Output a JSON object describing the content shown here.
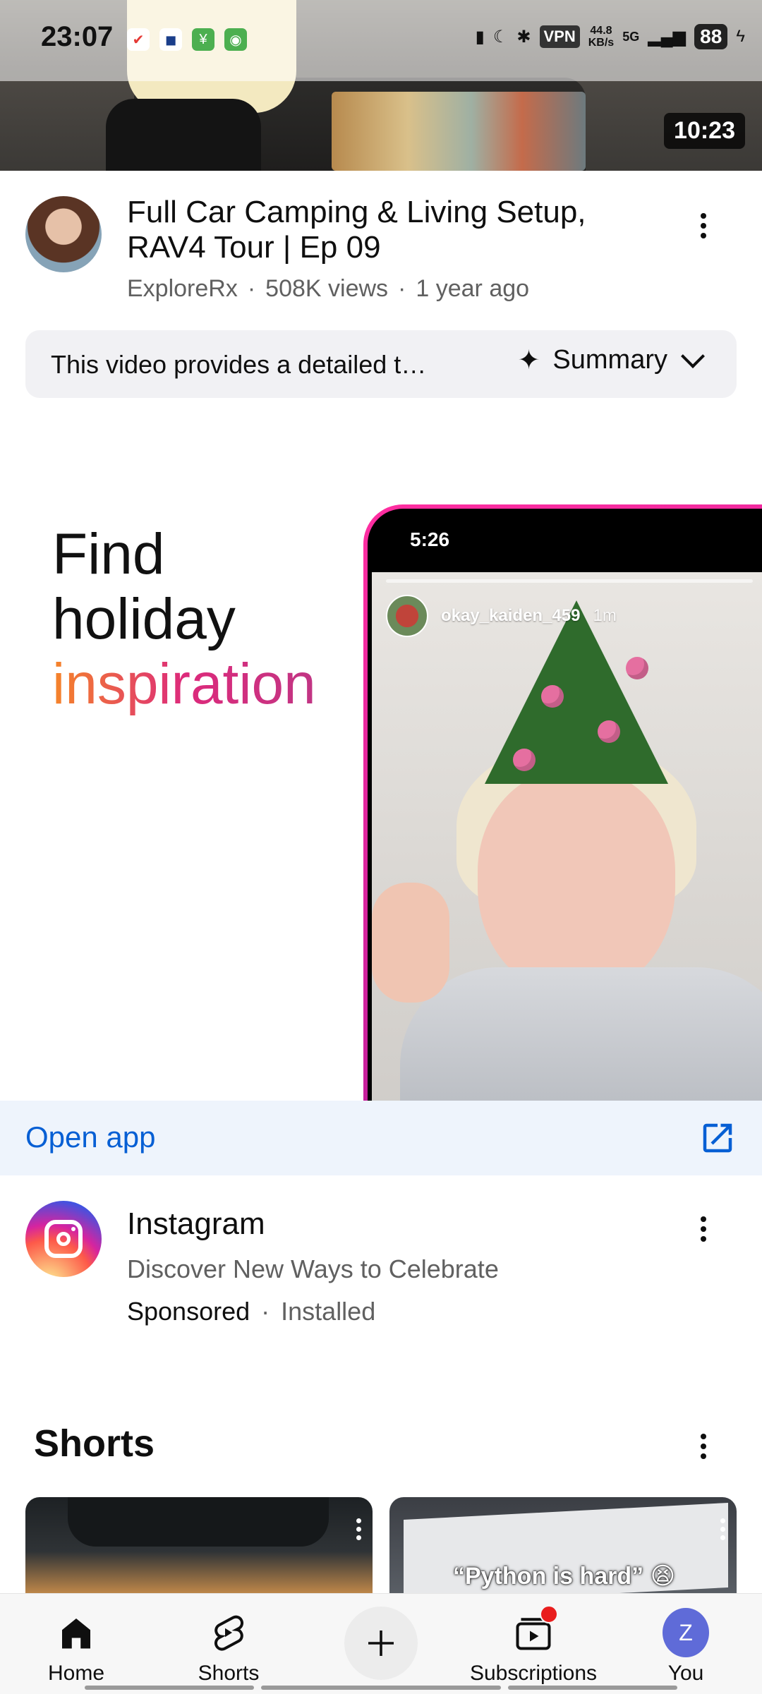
{
  "status_bar": {
    "time": "23:07",
    "vpn": "VPN",
    "speed_value": "44.8",
    "speed_unit": "KB/s",
    "network": "5G",
    "battery": "88"
  },
  "top_video": {
    "duration": "10:23",
    "title": "Full Car Camping & Living Setup, RAV4 Tour | Ep 09",
    "channel": "ExploreRx",
    "views": "508K views",
    "age": "1 year ago",
    "summary_text": "This video provides a detailed t…",
    "summary_label": "Summary"
  },
  "ad": {
    "headline_line1": "Find",
    "headline_line2": "holiday",
    "headline_line3": "inspiration",
    "phone_time": "5:26",
    "story_user": "okay_kaiden_459",
    "story_time": "1m",
    "open_app_label": "Open app",
    "advertiser": "Instagram",
    "description": "Discover New Ways to Celebrate",
    "sponsored": "Sponsored",
    "separator": "·",
    "installed": "Installed"
  },
  "shorts": {
    "title": "Shorts",
    "card2_caption": "“Python is hard” 😫"
  },
  "bottom_nav": {
    "home": "Home",
    "shorts": "Shorts",
    "subscriptions": "Subscriptions",
    "you": "You",
    "you_initial": "Z"
  },
  "colors": {
    "link_blue": "#065fd4",
    "open_app_bg": "#eef4fc",
    "notification_red": "#e91e1e",
    "avatar_purple": "#5f6bd8"
  }
}
